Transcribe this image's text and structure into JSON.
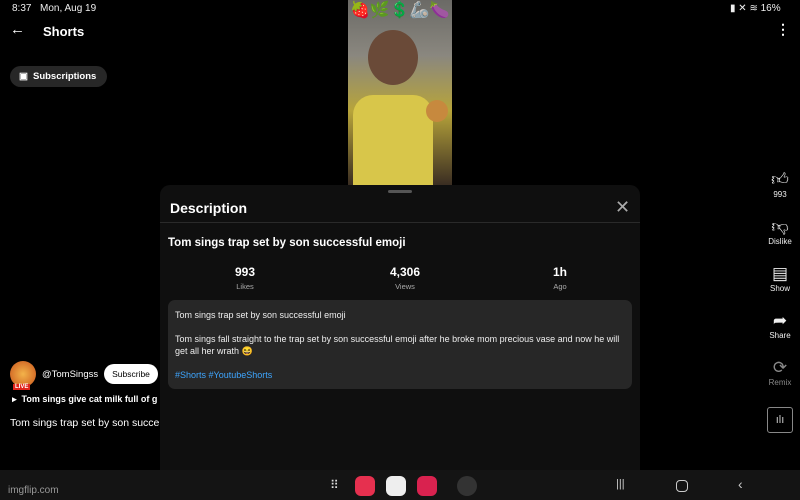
{
  "status_bar": {
    "time": "8:37",
    "date": "Mon, Aug 19",
    "battery": "16%"
  },
  "header": {
    "title": "Shorts"
  },
  "chips": {
    "subscriptions": "Subscriptions"
  },
  "video": {
    "overlay_emojis": "🍓🌿💲🦾🍆"
  },
  "actions": [
    {
      "icon": "thumbs-up-icon",
      "label": "993"
    },
    {
      "icon": "thumbs-down-icon",
      "label": "Dislike"
    },
    {
      "icon": "comment-icon",
      "label": "Show"
    },
    {
      "icon": "share-icon",
      "label": "Share"
    },
    {
      "icon": "remix-icon",
      "label": "Remix"
    }
  ],
  "channel": {
    "handle": "@TomSingss",
    "live_badge": "LIVE",
    "subscribe": "Subscribe",
    "playlist": "Tom sings give cat milk full of g",
    "caption": "Tom sings trap set by son succe"
  },
  "description_panel": {
    "title": "Description",
    "video_title": "Tom sings trap set by son successful emoji",
    "stats": [
      {
        "value": "993",
        "label": "Likes"
      },
      {
        "value": "4,306",
        "label": "Views"
      },
      {
        "value": "1h",
        "label": "Ago"
      }
    ],
    "body_line1": "Tom sings trap set by son successful emoji",
    "body_line2": "Tom sings fall straight to the trap set by son successful emoji after he broke mom precious vase and now he will get all her wrath 😆",
    "hashtags": "#Shorts #YoutubeShorts"
  },
  "watermark": "imgflip.com",
  "colors": {
    "accent_link": "#3ea6ff",
    "panel_bg": "#0f0f0f",
    "card_bg": "#272727"
  }
}
